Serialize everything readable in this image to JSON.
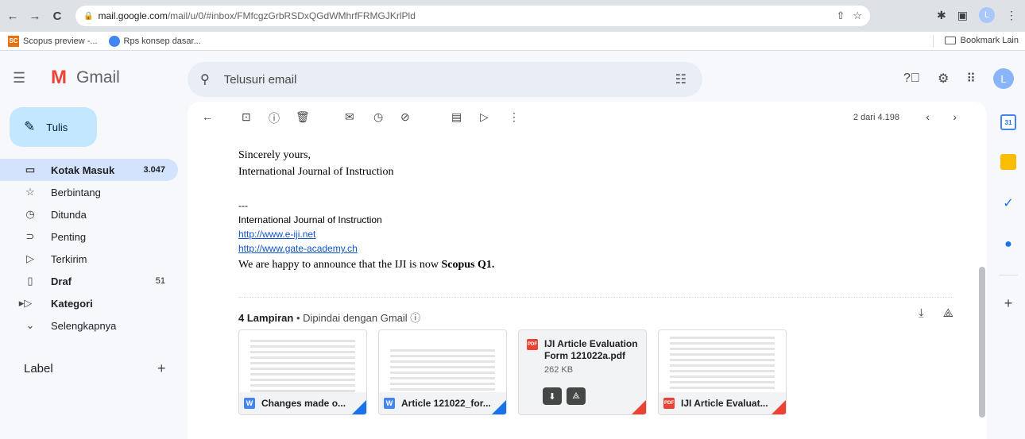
{
  "browser": {
    "back": "←",
    "forward": "→",
    "reload": "C",
    "url_domain": "mail.google.com",
    "url_path": "/mail/u/0/#inbox/FMfcgzGrbRSDxQGdWMhrfFRMGJKrlPld",
    "profile_initial": "L"
  },
  "bookmarks": {
    "items": [
      {
        "icon": "SC",
        "label": "Scopus preview -..."
      },
      {
        "label": "Rps konsep dasar..."
      }
    ],
    "other_label": "Bookmark Lain"
  },
  "gmail": {
    "logo_letter": "M",
    "app_name": "Gmail",
    "search_placeholder": "Telusuri email",
    "avatar_initial": "L"
  },
  "sidebar": {
    "compose_label": "Tulis",
    "items": [
      {
        "icon": "inbox",
        "label": "Kotak Masuk",
        "count": "3.047"
      },
      {
        "icon": "star",
        "label": "Berbintang",
        "count": ""
      },
      {
        "icon": "clock",
        "label": "Ditunda",
        "count": ""
      },
      {
        "icon": "important",
        "label": "Penting",
        "count": ""
      },
      {
        "icon": "send",
        "label": "Terkirim",
        "count": ""
      },
      {
        "icon": "draft",
        "label": "Draf",
        "count": "51"
      },
      {
        "icon": "label",
        "label": "Kategori",
        "count": ""
      },
      {
        "icon": "chevron",
        "label": "Selengkapnya",
        "count": ""
      }
    ],
    "label_header": "Label",
    "label_add": "+"
  },
  "toolbar": {
    "pager_text": "2 dari 4.198"
  },
  "email": {
    "closing": "Sincerely yours,",
    "signature": "International Journal of Instruction",
    "separator": "---",
    "org_name": "International Journal of Instruction",
    "link1": "http://www.e-iji.net",
    "link2": "http://www.gate-academy.ch",
    "announce_prefix": "We are happy to announce that the IJI is now ",
    "announce_bold": "Scopus Q1."
  },
  "attachments": {
    "count_label": "4 Lampiran",
    "scan_label": " • Dipindai dengan Gmail ⓘ",
    "items": [
      {
        "type": "word",
        "name": "Changes made o..."
      },
      {
        "type": "word",
        "name": "Article 121022_for..."
      },
      {
        "type": "pdf",
        "name": "IJI Article Evaluation Form 121022a.pdf",
        "size": "262 KB"
      },
      {
        "type": "pdf",
        "name": "IJI Article Evaluat..."
      }
    ]
  }
}
